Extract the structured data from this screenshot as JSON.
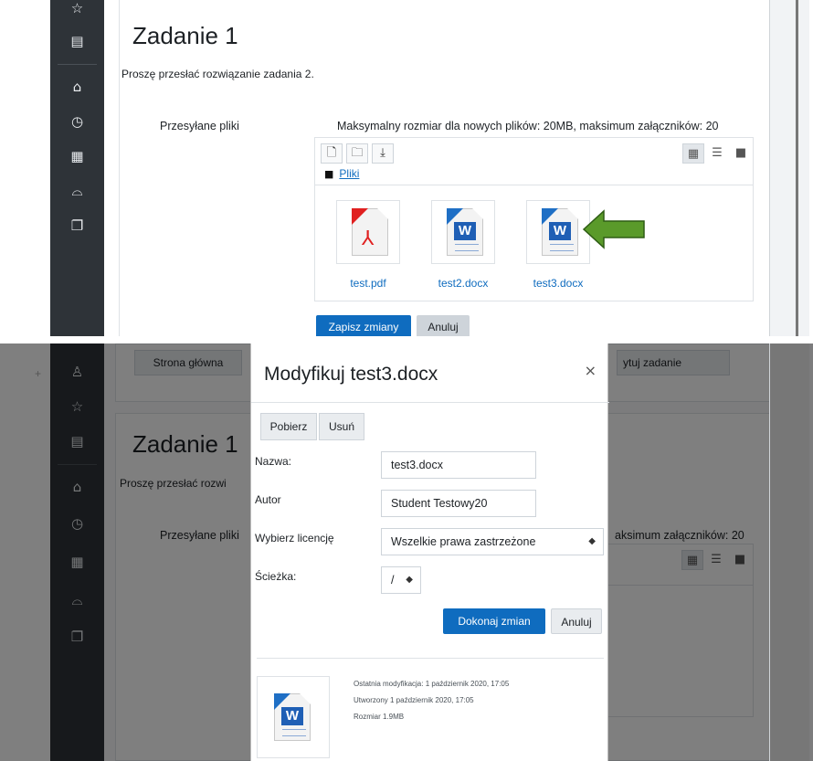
{
  "top": {
    "title": "Zadanie 1",
    "description": "Proszę przesłać rozwiązanie zadania 2.",
    "submitted_label": "Przesyłane pliki",
    "limits": "Maksymalny rozmiar dla nowych plików: 20MB, maksimum załączników: 20",
    "path_label": "Pliki",
    "files": [
      {
        "name": "test.pdf",
        "type": "pdf-file-icon"
      },
      {
        "name": "test2.docx",
        "type": "word-file-icon"
      },
      {
        "name": "test3.docx",
        "type": "word-file-icon"
      }
    ],
    "save_label": "Zapisz zmiany",
    "cancel_label": "Anuluj",
    "arrow_color": "#5a9a2a"
  },
  "sidebar_icons": [
    "star-icon",
    "book-icon",
    "home-icon",
    "dashboard-icon",
    "calendar-icon",
    "graduation-cap-icon",
    "files-icon",
    "badge-icon"
  ],
  "bottom": {
    "nav_home": "Strona główna",
    "nav_edit": "ytuj zadanie",
    "title": "Zadanie 1",
    "description_partial": "Proszę przesłać rozwi",
    "submitted_label": "Przesyłane pliki",
    "limits_partial": "aksimum załączników: 20",
    "modal": {
      "title": "Modyfikuj test3.docx",
      "download_label": "Pobierz",
      "delete_label": "Usuń",
      "name_label": "Nazwa:",
      "name_value": "test3.docx",
      "author_label": "Autor",
      "author_value": "Student Testowy20",
      "license_label": "Wybierz licencję",
      "license_value": "Wszelkie prawa zastrzeżone",
      "path_label": "Ścieżka:",
      "path_value": "/",
      "apply_label": "Dokonaj zmian",
      "cancel_label": "Anuluj",
      "modified": "Ostatnia modyfikacja:  1 październik 2020, 17:05",
      "created": "Utworzony  1 październik 2020, 17:05",
      "size": "Rozmiar  1.9MB"
    }
  },
  "colors": {
    "primary": "#0f6cbf",
    "sidebar": "#2e3338"
  }
}
